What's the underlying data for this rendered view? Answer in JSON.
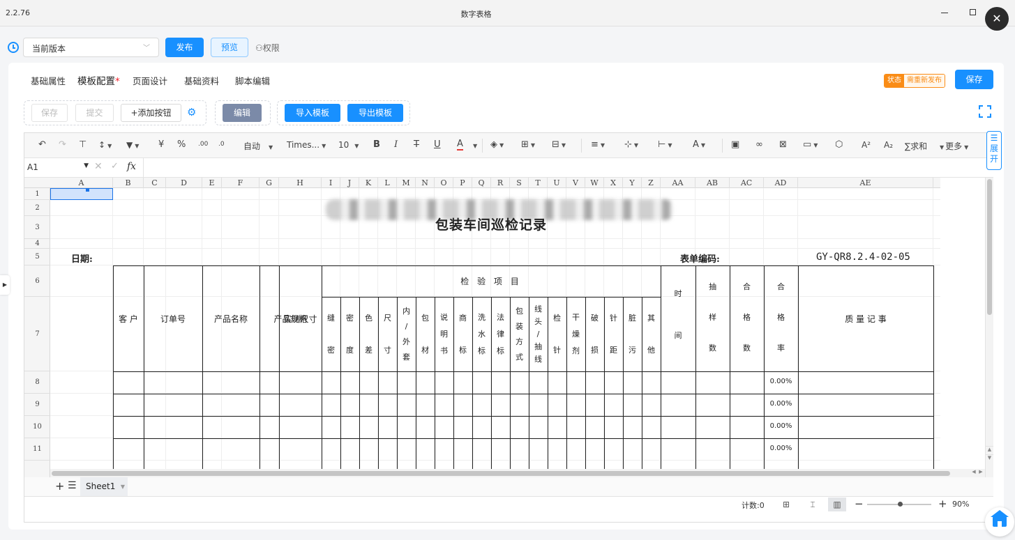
{
  "window": {
    "version": "2.2.76",
    "title": "数字表格",
    "close_icon": "✕"
  },
  "version_bar": {
    "selected": "当前版本",
    "publish": "发布",
    "preview": "预览",
    "permissions": "权限"
  },
  "tabs": [
    {
      "label": "基础属性"
    },
    {
      "label": "模板配置",
      "star": "*"
    },
    {
      "label": "页面设计"
    },
    {
      "label": "基础资料"
    },
    {
      "label": "脚本编辑"
    }
  ],
  "status": {
    "key": "状态",
    "value": "需重新发布"
  },
  "save_top": "保存",
  "actions": {
    "save": "保存",
    "submit": "提交",
    "add_button": "+添加按钮",
    "edit": "编辑",
    "import": "导入模板",
    "export": "导出模板"
  },
  "ribbon": {
    "currency": "¥",
    "percent": "%",
    "auto": "自动",
    "font": "Times...",
    "size": "10",
    "bold": "B",
    "italic": "I",
    "strike": "T",
    "underline": "U",
    "color": "A",
    "sum": "求和",
    "more": "更多",
    "expand": "展开"
  },
  "formula_bar": {
    "cell": "A1",
    "fx": "fx"
  },
  "columns": [
    "A",
    "B",
    "C",
    "D",
    "E",
    "F",
    "G",
    "H",
    "I",
    "J",
    "K",
    "L",
    "M",
    "N",
    "O",
    "P",
    "Q",
    "R",
    "S",
    "T",
    "U",
    "V",
    "W",
    "X",
    "Y",
    "Z",
    "AA",
    "AB",
    "AC",
    "AD",
    "AE"
  ],
  "rows": [
    "1",
    "2",
    "3",
    "4",
    "5",
    "6",
    "7",
    "8",
    "9",
    "10",
    "11"
  ],
  "sheet": {
    "title": "包装车间巡检记录",
    "date_label": "日期:",
    "code_label": "表单编码:",
    "code_value": "GY-QR8.2.4-02-05",
    "inspection_group": "检 验 项 目",
    "headers": {
      "customer": "客 户",
      "order_no": "订单号",
      "product_name": "产品名称",
      "product_spec": "产品规格",
      "measured_size": "实测尺寸",
      "time": [
        "时",
        "间"
      ],
      "sample": [
        "抽",
        "样",
        "数"
      ],
      "qualified": [
        "合",
        "格",
        "数"
      ],
      "rate": [
        "合",
        "格",
        "率"
      ],
      "quality": "质 量 记 事"
    },
    "inspection_items": [
      [
        "缝",
        "密"
      ],
      [
        "密",
        "度"
      ],
      [
        "色",
        "差"
      ],
      [
        "尺",
        "寸"
      ],
      [
        "内",
        "/",
        "外",
        "套"
      ],
      [
        "包",
        "材"
      ],
      [
        "说",
        "明",
        "书"
      ],
      [
        "商",
        "标"
      ],
      [
        "洗",
        "水",
        "标"
      ],
      [
        "法",
        "律",
        "标"
      ],
      [
        "包",
        "装",
        "方",
        "式"
      ],
      [
        "线",
        "头",
        "/",
        "抽",
        "线"
      ],
      [
        "检",
        "针"
      ],
      [
        "干",
        "燥",
        "剂"
      ],
      [
        "破",
        "损"
      ],
      [
        "针",
        "距"
      ],
      [
        "脏",
        "污"
      ],
      [
        "其",
        "他"
      ]
    ],
    "rates": [
      "0.00%",
      "0.00%",
      "0.00%",
      "0.00%"
    ]
  },
  "sheet_tab": "Sheet1",
  "statusbar": {
    "count": "计数:0",
    "zoom": "90%"
  }
}
